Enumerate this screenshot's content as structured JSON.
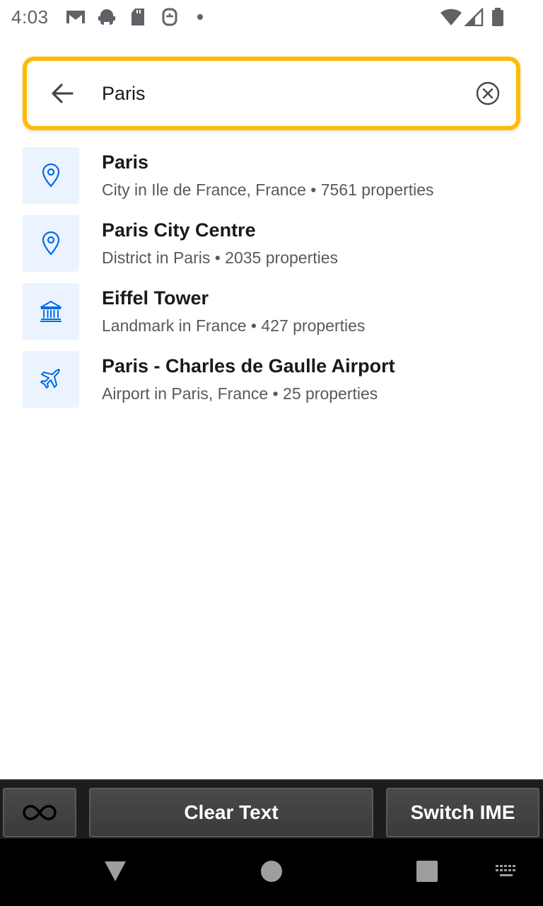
{
  "status_bar": {
    "time": "4:03",
    "left_icons": [
      "gmail-icon",
      "android-debug-icon",
      "sd-card-icon",
      "app-icon",
      "dot-icon"
    ],
    "right_icons": [
      "wifi-icon",
      "cell-signal-icon",
      "battery-icon"
    ]
  },
  "search": {
    "value": "Paris",
    "back_icon": "arrow-left-icon",
    "clear_icon": "clear-circle-icon",
    "border_color": "#febb02"
  },
  "results": [
    {
      "icon": "location-pin-icon",
      "title": "Paris",
      "subtitle": "City in Ile de France, France • 7561 properties"
    },
    {
      "icon": "location-pin-icon",
      "title": "Paris City Centre",
      "subtitle": "District in Paris • 2035 properties"
    },
    {
      "icon": "landmark-icon",
      "title": "Eiffel Tower",
      "subtitle": "Landmark in France • 427 properties"
    },
    {
      "icon": "airplane-icon",
      "title": "Paris - Charles de Gaulle Airport",
      "subtitle": "Airport in Paris, France • 25 properties"
    }
  ],
  "colors": {
    "accent": "#006ce4",
    "icon_bg": "#ebf3ff"
  },
  "ime_bar": {
    "logo_icon": "infinity-icon",
    "clear_text_label": "Clear Text",
    "switch_ime_label": "Switch IME"
  },
  "nav_bar": {
    "icons": [
      "back-triangle-icon",
      "home-circle-icon",
      "recents-square-icon",
      "keyboard-icon"
    ]
  }
}
